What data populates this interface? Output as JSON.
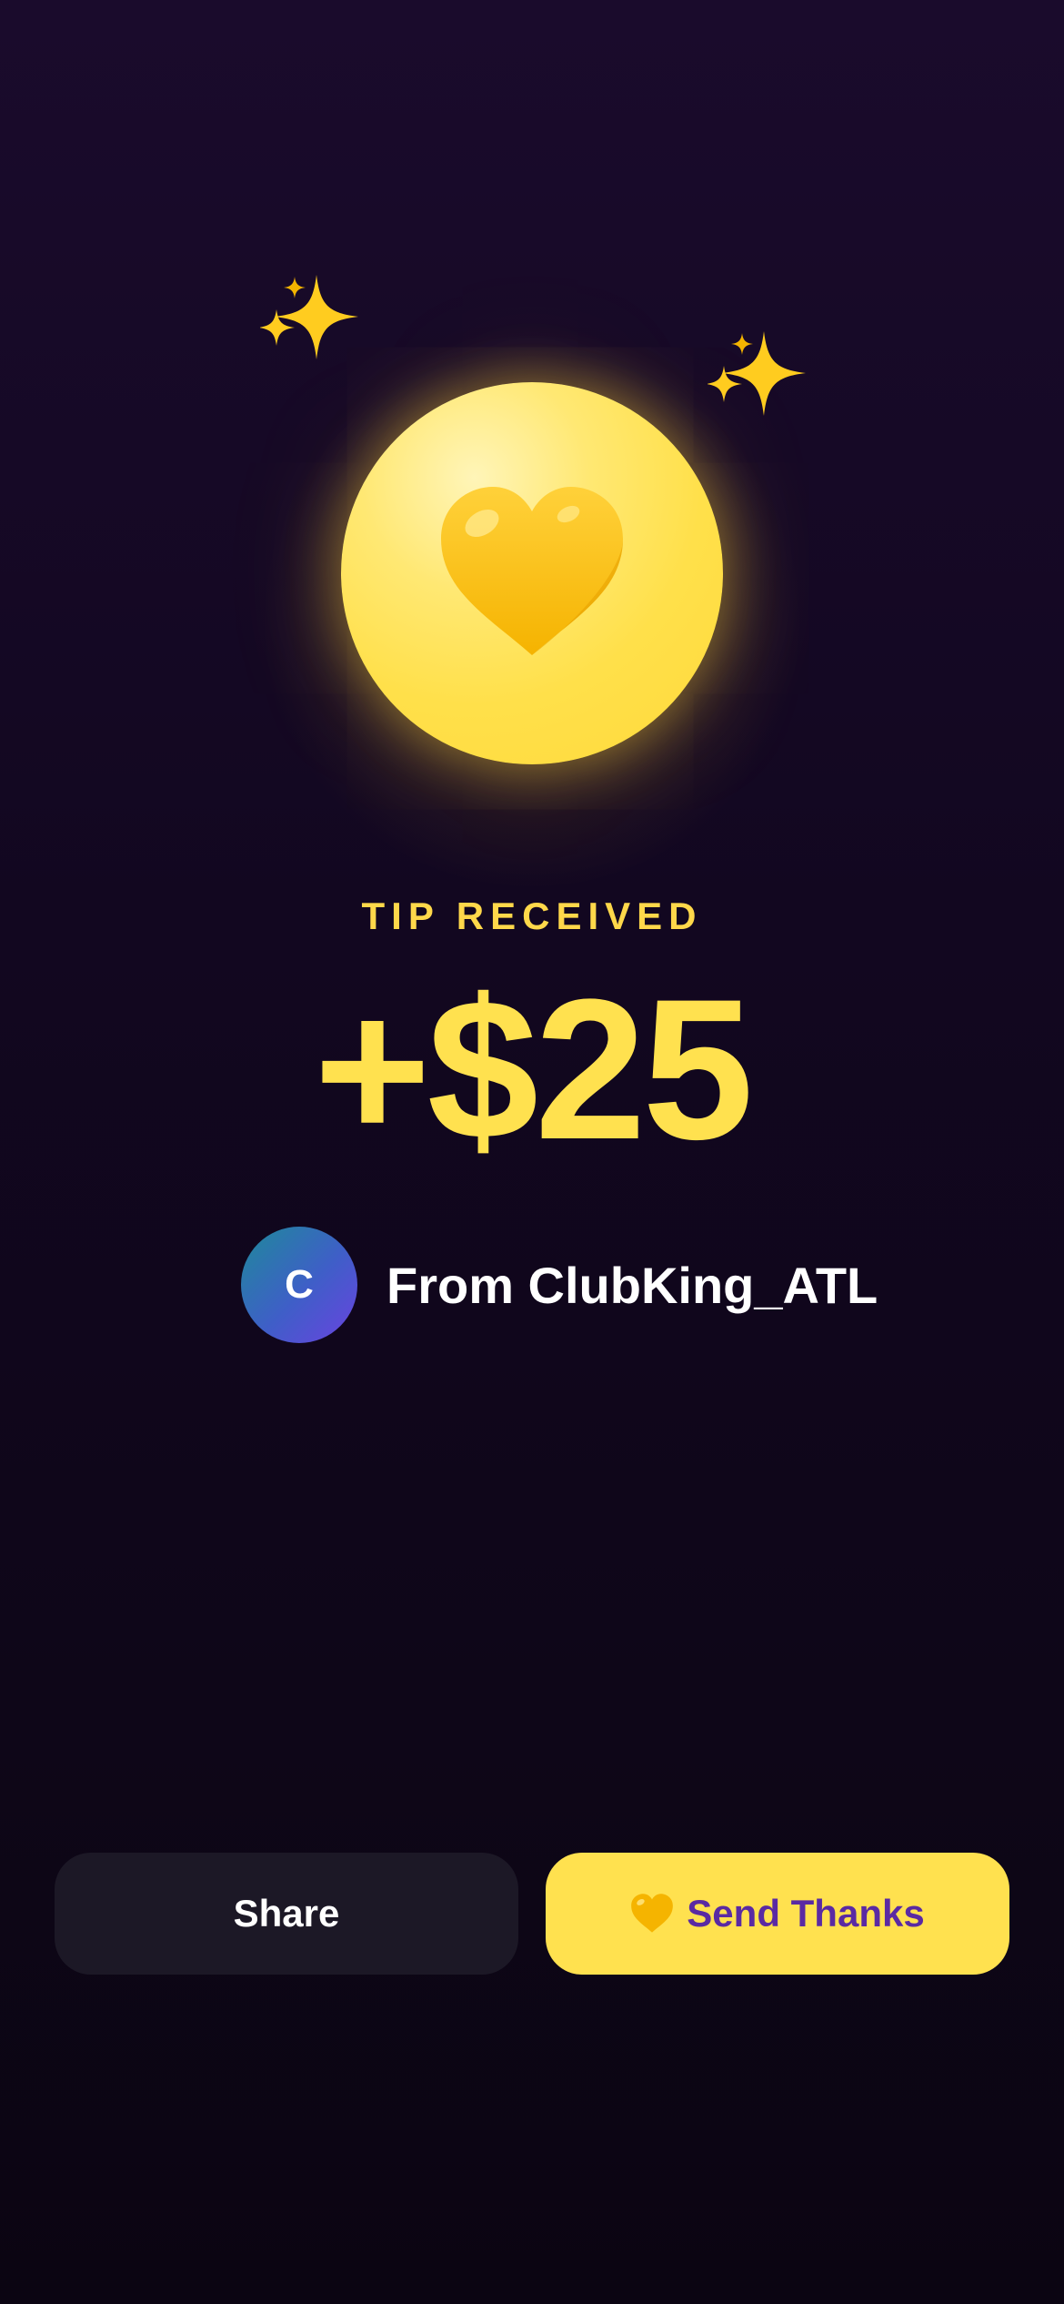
{
  "tip": {
    "eyebrow": "TIP RECEIVED",
    "amount": "+$25"
  },
  "sender": {
    "avatar_initial": "C",
    "label": "From ClubKing_ATL"
  },
  "actions": {
    "share_label": "Share",
    "thanks_label": "Send Thanks"
  },
  "icons": {
    "hero": "yellow-heart-icon",
    "decor": "sparkles-icon",
    "button": "yellow-heart-icon"
  },
  "colors": {
    "accent": "#ffe14f",
    "thanks_text": "#5a2aa3",
    "share_bg": "#1c1826"
  }
}
